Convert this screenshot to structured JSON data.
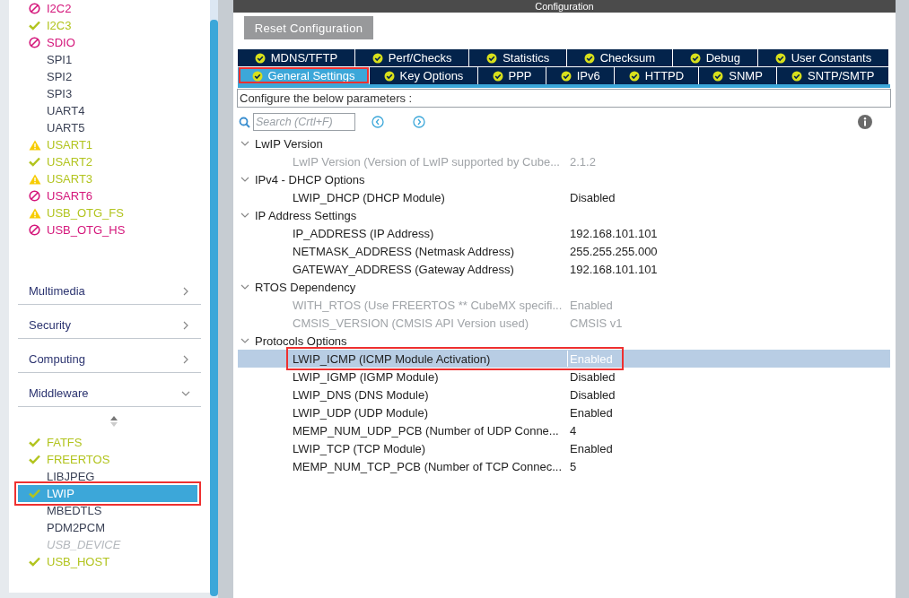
{
  "header": {
    "title": "Configuration"
  },
  "sidebar": {
    "items": [
      {
        "label": "I2C2",
        "kind": "disabled"
      },
      {
        "label": "I2C3",
        "kind": "ok"
      },
      {
        "label": "SDIO",
        "kind": "disabled"
      },
      {
        "label": "SPI1",
        "kind": "none"
      },
      {
        "label": "SPI2",
        "kind": "none"
      },
      {
        "label": "SPI3",
        "kind": "none"
      },
      {
        "label": "UART4",
        "kind": "none"
      },
      {
        "label": "UART5",
        "kind": "none"
      },
      {
        "label": "USART1",
        "kind": "warning"
      },
      {
        "label": "USART2",
        "kind": "ok"
      },
      {
        "label": "USART3",
        "kind": "warning"
      },
      {
        "label": "USART6",
        "kind": "disabled"
      },
      {
        "label": "USB_OTG_FS",
        "kind": "warning"
      },
      {
        "label": "USB_OTG_HS",
        "kind": "disabled"
      }
    ],
    "categories": [
      {
        "label": "Multimedia",
        "expanded": false
      },
      {
        "label": "Security",
        "expanded": false
      },
      {
        "label": "Computing",
        "expanded": false
      },
      {
        "label": "Middleware",
        "expanded": true
      }
    ],
    "middleware": [
      {
        "label": "FATFS",
        "kind": "ok",
        "selected": false,
        "highlighted": false
      },
      {
        "label": "FREERTOS",
        "kind": "ok",
        "selected": false,
        "highlighted": false
      },
      {
        "label": "LIBJPEG",
        "kind": "none",
        "selected": false,
        "highlighted": false
      },
      {
        "label": "LWIP",
        "kind": "ok",
        "selected": true,
        "highlighted": true
      },
      {
        "label": "MBEDTLS",
        "kind": "none",
        "selected": false,
        "highlighted": false
      },
      {
        "label": "PDM2PCM",
        "kind": "none",
        "selected": false,
        "highlighted": false
      },
      {
        "label": "USB_DEVICE",
        "kind": "unavailable",
        "selected": false,
        "highlighted": false
      },
      {
        "label": "USB_HOST",
        "kind": "ok",
        "selected": false,
        "highlighted": false
      }
    ]
  },
  "reset_button": "Reset Configuration",
  "tab_rows": [
    [
      {
        "label": "MDNS/TFTP",
        "selected": false,
        "highlighted": false
      },
      {
        "label": "Perf/Checks",
        "selected": false,
        "highlighted": false
      },
      {
        "label": "Statistics",
        "selected": false,
        "highlighted": false
      },
      {
        "label": "Checksum",
        "selected": false,
        "highlighted": false
      },
      {
        "label": "Debug",
        "selected": false,
        "highlighted": false
      },
      {
        "label": "User Constants",
        "selected": false,
        "highlighted": false
      }
    ],
    [
      {
        "label": "General Settings",
        "selected": true,
        "highlighted": true
      },
      {
        "label": "Key Options",
        "selected": false,
        "highlighted": false
      },
      {
        "label": "PPP",
        "selected": false,
        "highlighted": false
      },
      {
        "label": "IPv6",
        "selected": false,
        "highlighted": false
      },
      {
        "label": "HTTPD",
        "selected": false,
        "highlighted": false
      },
      {
        "label": "SNMP",
        "selected": false,
        "highlighted": false
      },
      {
        "label": "SNTP/SMTP",
        "selected": false,
        "highlighted": false
      }
    ]
  ],
  "description": "Configure the below parameters :",
  "search": {
    "placeholder": "Search (Crtl+F)"
  },
  "groups": [
    {
      "title": "LwIP Version",
      "expanded": true,
      "children": [
        {
          "name": "LwIP Version (Version of LwIP supported by Cube...",
          "value": "2.1.2",
          "disabled": true,
          "selected": false,
          "highlighted": false
        }
      ]
    },
    {
      "title": "IPv4 - DHCP Options",
      "expanded": true,
      "children": [
        {
          "name": "LWIP_DHCP (DHCP Module)",
          "value": "Disabled",
          "disabled": false,
          "selected": false,
          "highlighted": false
        }
      ]
    },
    {
      "title": "IP Address Settings",
      "expanded": true,
      "children": [
        {
          "name": "IP_ADDRESS (IP Address)",
          "value": "192.168.101.101",
          "disabled": false,
          "selected": false,
          "highlighted": false
        },
        {
          "name": "NETMASK_ADDRESS (Netmask Address)",
          "value": "255.255.255.000",
          "disabled": false,
          "selected": false,
          "highlighted": false
        },
        {
          "name": "GATEWAY_ADDRESS (Gateway Address)",
          "value": "192.168.101.101",
          "disabled": false,
          "selected": false,
          "highlighted": false
        }
      ]
    },
    {
      "title": "RTOS Dependency",
      "expanded": true,
      "children": [
        {
          "name": "WITH_RTOS (Use FREERTOS ** CubeMX specifi...",
          "value": "Enabled",
          "disabled": true,
          "selected": false,
          "highlighted": false
        },
        {
          "name": "CMSIS_VERSION (CMSIS API Version used)",
          "value": "CMSIS v1",
          "disabled": true,
          "selected": false,
          "highlighted": false
        }
      ]
    },
    {
      "title": "Protocols Options",
      "expanded": true,
      "children": [
        {
          "name": "LWIP_ICMP (ICMP Module Activation)",
          "value": "Enabled",
          "disabled": false,
          "selected": true,
          "highlighted": true
        },
        {
          "name": "LWIP_IGMP (IGMP Module)",
          "value": "Disabled",
          "disabled": false,
          "selected": false,
          "highlighted": false
        },
        {
          "name": "LWIP_DNS (DNS Module)",
          "value": "Disabled",
          "disabled": false,
          "selected": false,
          "highlighted": false
        },
        {
          "name": "LWIP_UDP (UDP Module)",
          "value": "Enabled",
          "disabled": false,
          "selected": false,
          "highlighted": false
        },
        {
          "name": "MEMP_NUM_UDP_PCB (Number of UDP Conne...",
          "value": "4",
          "disabled": false,
          "selected": false,
          "highlighted": false
        },
        {
          "name": "LWIP_TCP (TCP Module)",
          "value": "Enabled",
          "disabled": false,
          "selected": false,
          "highlighted": false
        },
        {
          "name": "MEMP_NUM_TCP_PCB (Number of TCP Connec...",
          "value": "5",
          "disabled": false,
          "selected": false,
          "highlighted": false
        }
      ]
    }
  ]
}
